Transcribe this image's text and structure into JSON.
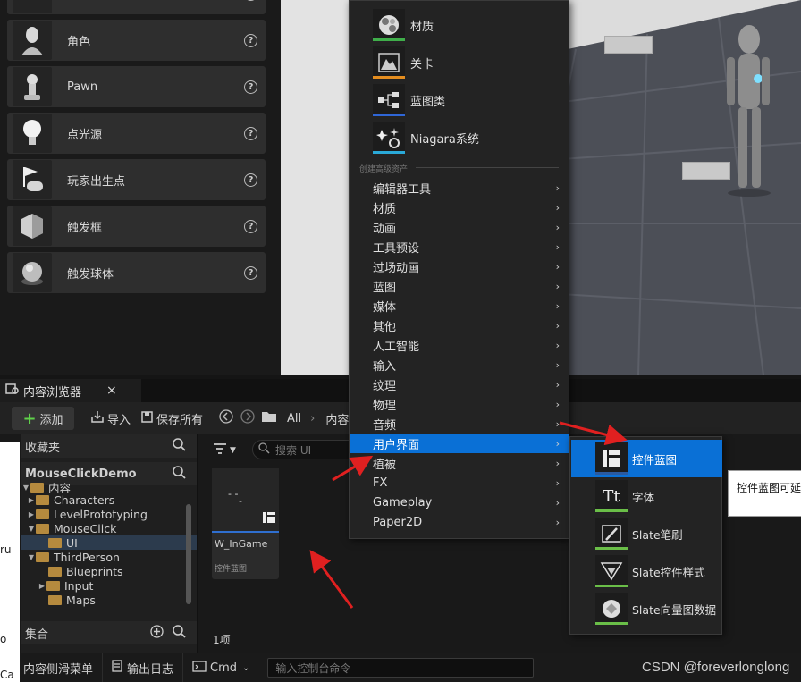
{
  "place_actors": [
    {
      "label": "",
      "icon": "partial-actor-icon"
    },
    {
      "label": "角色",
      "icon": "character-icon"
    },
    {
      "label": "Pawn",
      "icon": "pawn-icon"
    },
    {
      "label": "点光源",
      "icon": "point-light-icon"
    },
    {
      "label": "玩家出生点",
      "icon": "player-start-icon"
    },
    {
      "label": "触发框",
      "icon": "trigger-box-icon"
    },
    {
      "label": "触发球体",
      "icon": "trigger-sphere-icon"
    }
  ],
  "help_glyph": "?",
  "context_menu": {
    "basic_assets": [
      {
        "label": "材质",
        "icon": "material-icon",
        "color": "#3fae4a"
      },
      {
        "label": "关卡",
        "icon": "level-icon",
        "color": "#e48d1f"
      },
      {
        "label": "蓝图类",
        "icon": "blueprint-class-icon",
        "color": "#2f66d6"
      },
      {
        "label": "Niagara系统",
        "icon": "niagara-system-icon",
        "color": "#2aa9d8"
      }
    ],
    "advanced_header": "创建高级资产",
    "items": [
      "编辑器工具",
      "材质",
      "动画",
      "工具预设",
      "过场动画",
      "蓝图",
      "媒体",
      "其他",
      "人工智能",
      "输入",
      "纹理",
      "物理",
      "音频",
      "用户界面",
      "植被",
      "FX",
      "Gameplay",
      "Paper2D"
    ],
    "highlighted": "用户界面",
    "chevron": "›"
  },
  "submenu": {
    "items": [
      {
        "label": "控件蓝图",
        "icon": "widget-blueprint-icon"
      },
      {
        "label": "字体",
        "icon": "font-icon",
        "glyph": "Tt"
      },
      {
        "label": "Slate笔刷",
        "icon": "slate-brush-icon"
      },
      {
        "label": "Slate控件样式",
        "icon": "slate-widget-style-icon"
      },
      {
        "label": "Slate向量图数据",
        "icon": "slate-vector-art-icon"
      }
    ],
    "highlighted": "控件蓝图"
  },
  "tooltip": "控件蓝图可延",
  "content_browser": {
    "tab_title": "内容浏览器",
    "close_glyph": "×",
    "toolbar": {
      "add": "添加",
      "import": "导入",
      "save_all": "保存所有",
      "path_all": "All",
      "path_next": "内容"
    },
    "favorites": "收藏夹",
    "project": "MouseClickDemo",
    "tree": [
      {
        "label": "内容",
        "level": 0,
        "arrow": "▼"
      },
      {
        "label": "Characters",
        "level": 1,
        "arrow": "▶"
      },
      {
        "label": "LevelPrototyping",
        "level": 1,
        "arrow": "▶"
      },
      {
        "label": "MouseClick",
        "level": 1,
        "arrow": "▼"
      },
      {
        "label": "UI",
        "level": 2,
        "arrow": "",
        "selected": true
      },
      {
        "label": "ThirdPerson",
        "level": 1,
        "arrow": "▼"
      },
      {
        "label": "Blueprints",
        "level": 2,
        "arrow": ""
      },
      {
        "label": "Input",
        "level": 2,
        "arrow": "▶"
      },
      {
        "label": "Maps",
        "level": 2,
        "arrow": ""
      }
    ],
    "collections": "集合",
    "search_placeholder": "搜索 UI",
    "asset": {
      "name": "W_InGame",
      "type": "控件蓝图"
    },
    "item_count": "1项"
  },
  "bottom_bar": {
    "drawer": "内容侧滑菜单",
    "output_log": "输出日志",
    "cmd": "Cmd",
    "console_placeholder": "输入控制台命令"
  },
  "left_sliver_text": [
    "ru",
    "o",
    "Ca"
  ],
  "watermark": "CSDN @foreverlonglong",
  "colors": {
    "highlight": "#0a70d6",
    "arrow": "#e02020"
  }
}
